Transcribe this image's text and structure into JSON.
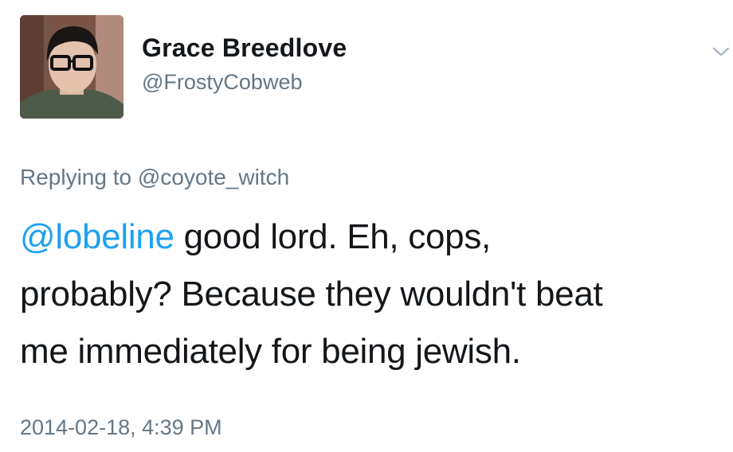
{
  "tweet": {
    "author": {
      "display_name": "Grace Breedlove",
      "handle": "@FrostyCobweb",
      "avatar_icon": "profile-photo"
    },
    "menu_icon": "chevron-down-icon",
    "reply_context": {
      "prefix": "Replying to",
      "mention": "@coyote_witch"
    },
    "body": {
      "mention": "@lobeline",
      "line1_rest": " good lord. Eh, cops,",
      "line2": "probably? Because they wouldn't beat",
      "line3": "me immediately for being jewish."
    },
    "timestamp": "2014-02-18, 4:39 PM",
    "colors": {
      "link_blue": "#1da1f2",
      "secondary_gray": "#657786",
      "text_dark": "#14171a"
    }
  }
}
